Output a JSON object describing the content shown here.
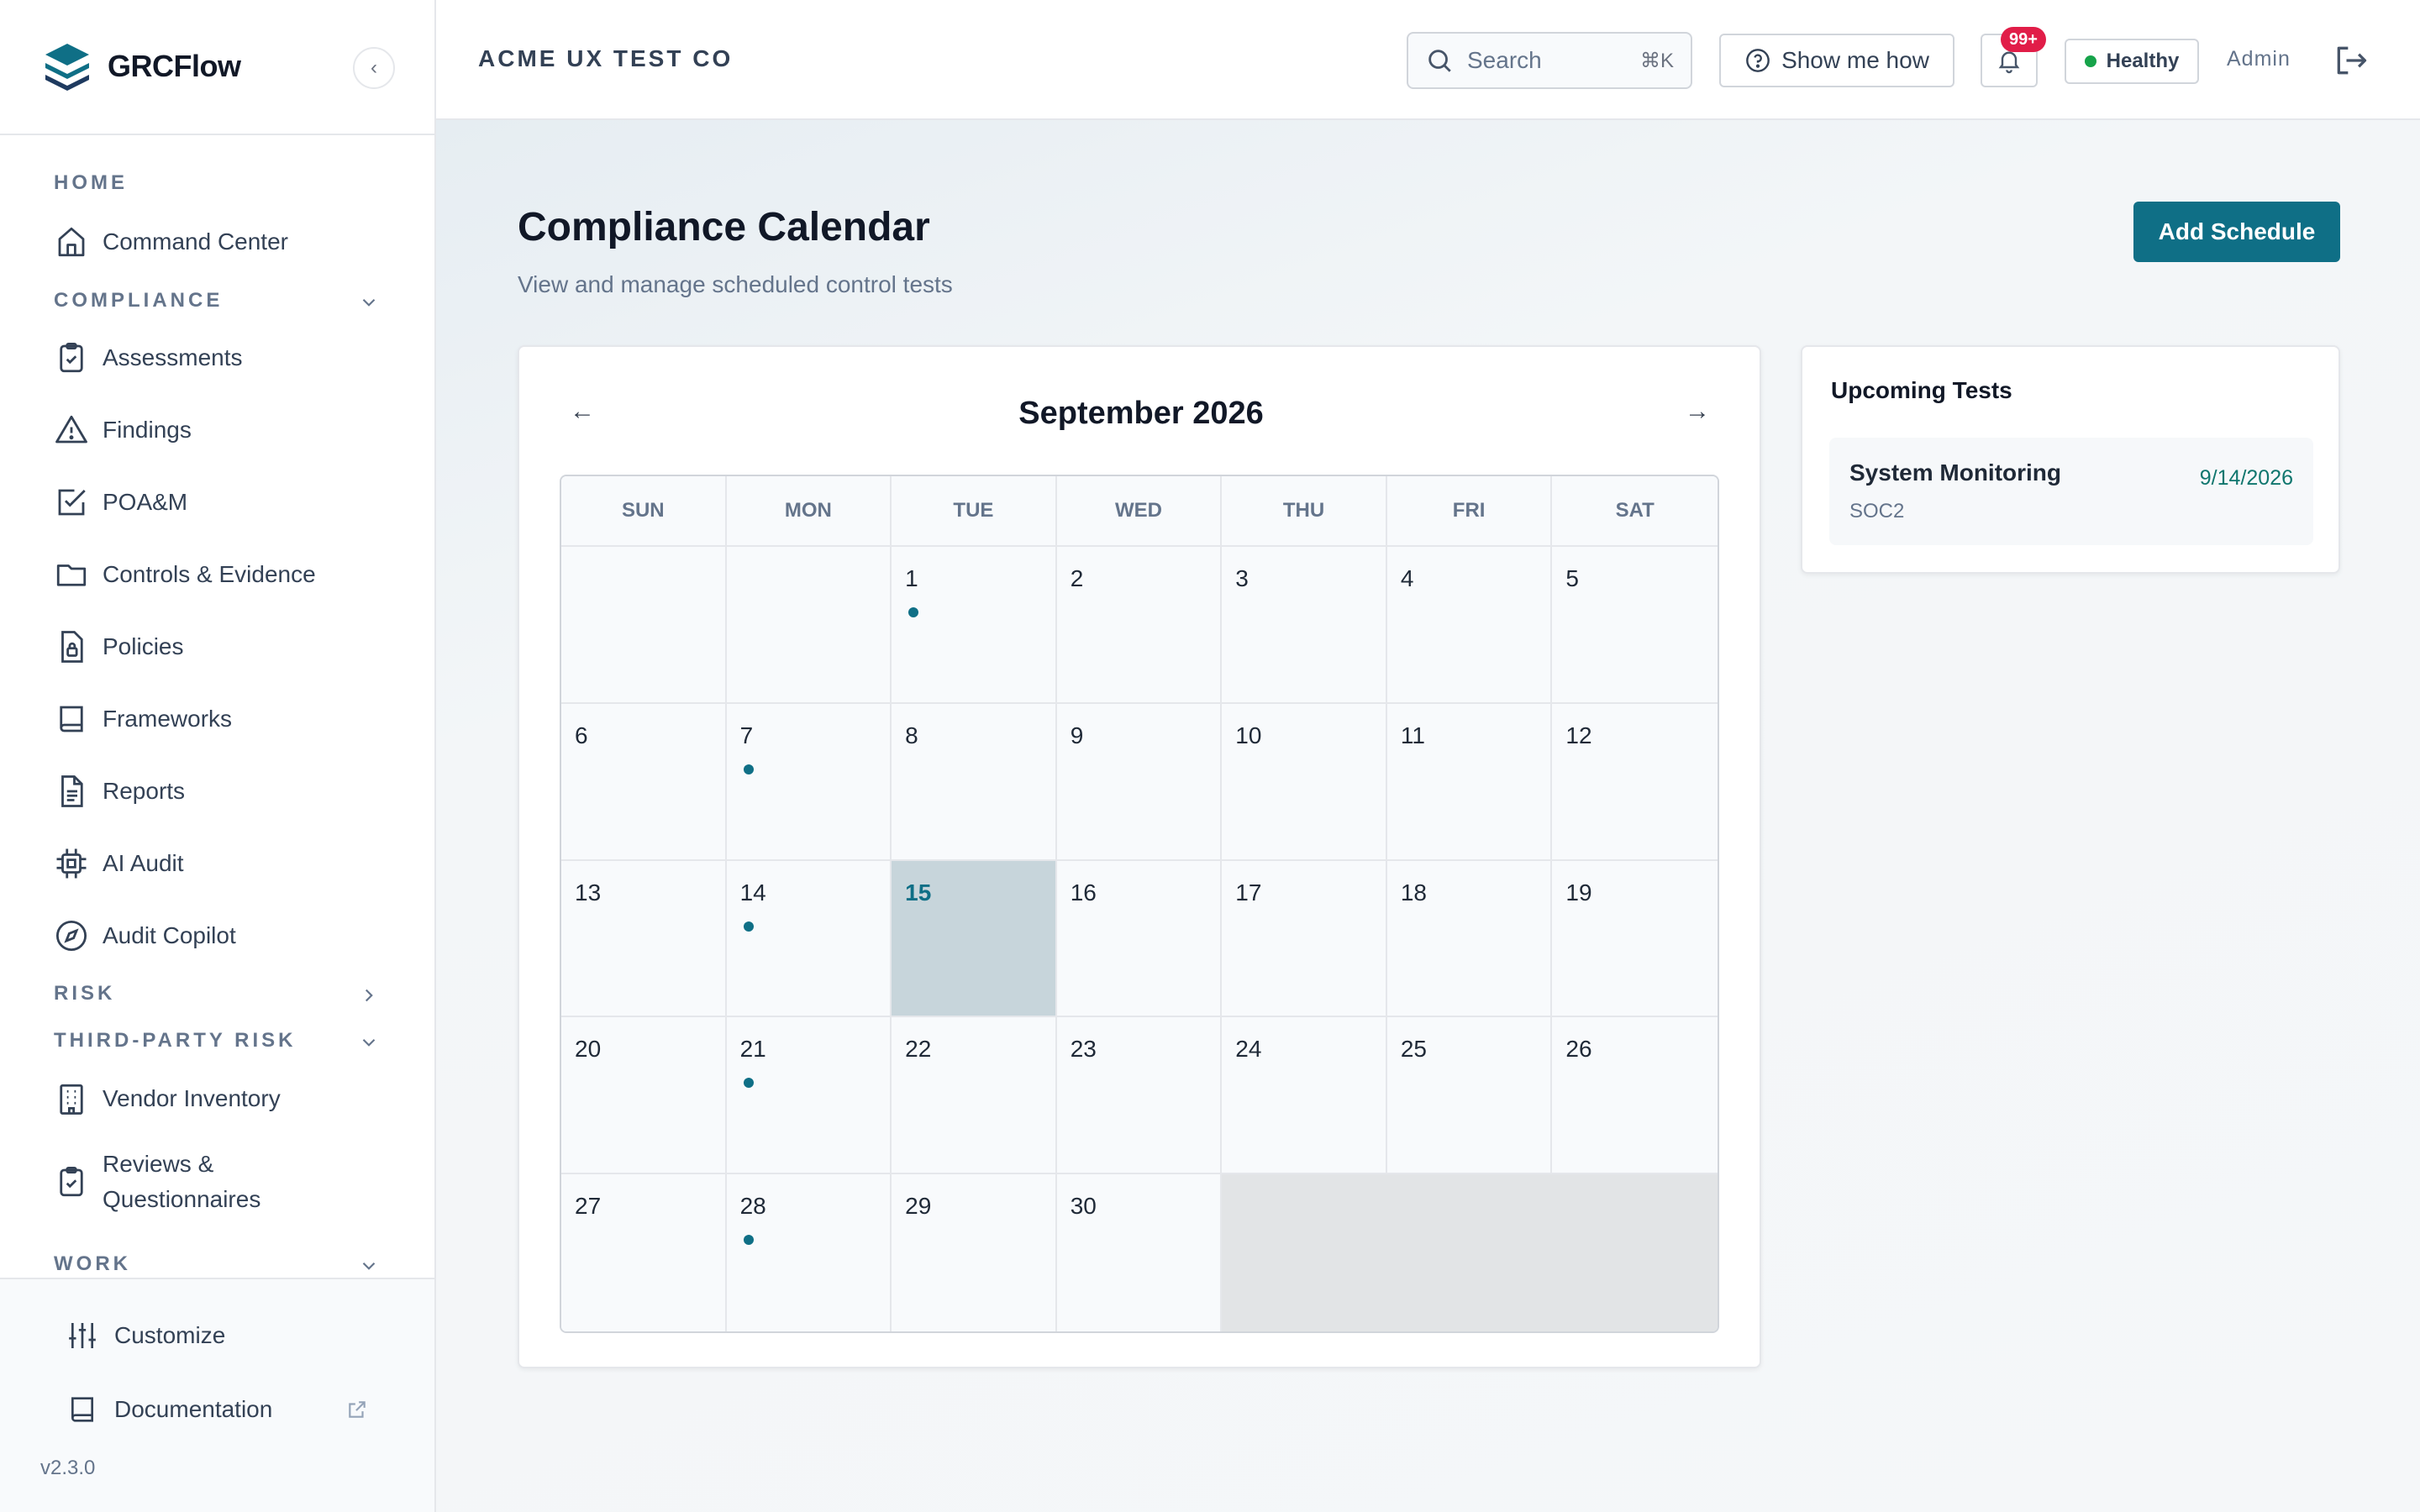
{
  "brand": {
    "name": "GRCFlow"
  },
  "sidebar": {
    "sections": {
      "home": "HOME",
      "compliance": "COMPLIANCE",
      "risk": "RISK",
      "third_party": "THIRD-PARTY RISK",
      "work": "WORK"
    },
    "items": {
      "command_center": "Command Center",
      "assessments": "Assessments",
      "findings": "Findings",
      "poam": "POA&M",
      "controls": "Controls & Evidence",
      "policies": "Policies",
      "frameworks": "Frameworks",
      "reports": "Reports",
      "ai_audit": "AI Audit",
      "audit_copilot": "Audit Copilot",
      "vendor_inventory": "Vendor Inventory",
      "reviews_line1": "Reviews &",
      "reviews_line2": "Questionnaires"
    },
    "footer": {
      "customize": "Customize",
      "documentation": "Documentation",
      "version": "v2.3.0"
    }
  },
  "topbar": {
    "org": "ACME UX TEST CO",
    "search_placeholder": "Search",
    "search_shortcut": "⌘K",
    "show_me_how": "Show me how",
    "notifications": "99+",
    "health": "Healthy",
    "user": "Admin"
  },
  "page": {
    "title": "Compliance Calendar",
    "subtitle": "View and manage scheduled control tests",
    "add_button": "Add Schedule"
  },
  "calendar": {
    "prev": "←",
    "next": "→",
    "month_label": "September 2026",
    "weekdays": [
      "SUN",
      "MON",
      "TUE",
      "WED",
      "THU",
      "FRI",
      "SAT"
    ],
    "leading_blanks": 2,
    "days_in_month": 30,
    "today": 15,
    "event_days": [
      1,
      7,
      14,
      21,
      28
    ]
  },
  "upcoming": {
    "title": "Upcoming Tests",
    "items": [
      {
        "name": "System Monitoring",
        "framework": "SOC2",
        "date": "9/14/2026"
      }
    ]
  }
}
